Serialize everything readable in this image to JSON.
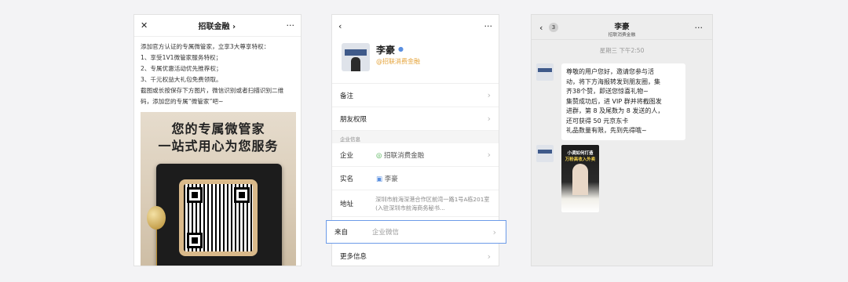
{
  "panel1": {
    "close_icon": "✕",
    "title": "招联金融 ›",
    "more": "···",
    "lines": [
      "添加官方认证的专属微管家，立享3大尊享特权：",
      "1、享受1V1微管家服务特权；",
      "2、专属优惠活动优先推荐权；",
      "3、千元权益大礼包免费领取。",
      "截图或长按保存下方图片，微信识别或者扫描识别二维",
      "码，添加您的专属“微管家”吧~"
    ],
    "poster_line1": "您的专属微管家",
    "poster_line2": "一站式用心为您服务"
  },
  "panel2": {
    "back": "‹",
    "more": "···",
    "name": "李豪",
    "corp": "@招联消费金融",
    "rows": [
      "备注",
      "朋友权限"
    ],
    "section": "企业信息",
    "company_label": "企业",
    "company_value": "招联消费金融",
    "realname_label": "实名",
    "realname_value": "李豪",
    "address_label": "地址",
    "address_value": "深圳市前海深港合作区前湾一路1号A栋201室(入驻深圳市前海商务秘书...",
    "from_label": "来自",
    "from_value": "企业微信",
    "more_info": "更多信息"
  },
  "panel3": {
    "back": "‹",
    "unread": "3",
    "title": "李豪",
    "subtitle": "招联消费金融",
    "more": "···",
    "time": "星期三 下午2:50",
    "message": [
      "尊敬的用户您好，邀请您参与活",
      "动，将下方海报转发到朋友圈，集",
      "齐38个赞，即送您惊喜礼物~",
      "集赞成功后，进 VIP 群并将截图发",
      "进群，第 8 及尾数为 8 发送的人，",
      "还可获得 50 元京东卡",
      "礼品数量有限，先到先得哦~"
    ],
    "poster_line1": "小调如何打造",
    "poster_line2": "万粉高收入外卖"
  }
}
